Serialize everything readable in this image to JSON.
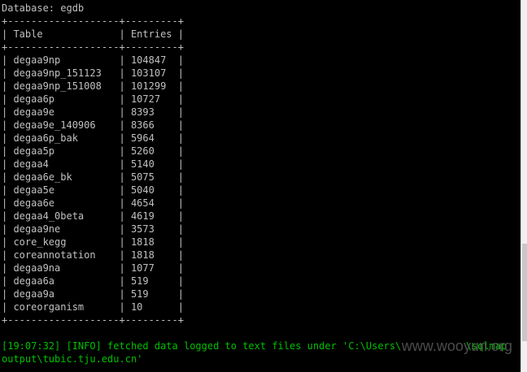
{
  "database_line": "Database: egdb",
  "table": {
    "border": "+-------------------+---------+",
    "header_line": "| Table             | Entries |",
    "rows": [
      "| degaa9np          | 104847  |",
      "| degaa9np_151123   | 103107  |",
      "| degaa9np_151008   | 101299  |",
      "| degaa6p           | 10727   |",
      "| degaa9e           | 8393    |",
      "| degaa9e_140906    | 8366    |",
      "| degaa6p_bak       | 5964    |",
      "| degaa5p           | 5260    |",
      "| degaa4            | 5140    |",
      "| degaa6e_bk        | 5075    |",
      "| degaa5e           | 5040    |",
      "| degaa6e           | 4654    |",
      "| degaa4_0beta      | 4619    |",
      "| degaa9ne          | 3573    |",
      "| core_kegg         | 1818    |",
      "| coreannotation    | 1818    |",
      "| degaa9na          | 1077    |",
      "| degaa6a           | 519     |",
      "| degaa9a           | 519     |",
      "| coreorganism      | 10      |"
    ]
  },
  "info_line_1": "[19:07:32] [INFO] fetched data logged to text files under 'C:\\Users\\           \\sqlmap",
  "info_line_2": "output\\tubic.tju.edu.cn'",
  "watermark": "www.wooyun.org",
  "colors": {
    "background": "#000000",
    "text": "#c0c0c0",
    "info": "#00c000"
  }
}
